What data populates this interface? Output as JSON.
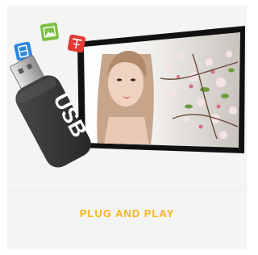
{
  "feature": {
    "title": "PLUG AND PLAY",
    "usb_label": "USB",
    "icons": [
      {
        "name": "document-icon",
        "color": "#2e86de"
      },
      {
        "name": "image-icon",
        "color": "#7bc043"
      },
      {
        "name": "text-icon",
        "color": "#e53935"
      }
    ],
    "accent_color": "#f2b51c"
  }
}
